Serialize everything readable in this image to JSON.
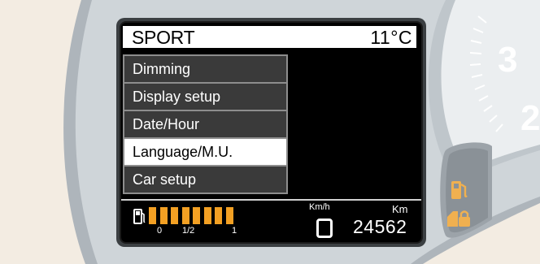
{
  "display": {
    "drive_mode": "SPORT",
    "temperature": "11°C",
    "menu_items": [
      {
        "label": "Dimming",
        "selected": false
      },
      {
        "label": "Display setup",
        "selected": false
      },
      {
        "label": "Date/Hour",
        "selected": false
      },
      {
        "label": "Language/M.U.",
        "selected": true
      },
      {
        "label": "Car setup",
        "selected": false
      }
    ],
    "fuel": {
      "level_fraction": 1.0,
      "segments": 8,
      "tick_labels": [
        "0",
        "1/2",
        "1"
      ],
      "color": "#f3a023",
      "icon": "fuel-pump-icon"
    },
    "speed_unit": "Km/h",
    "odometer_unit": "Km",
    "odometer_value": "24562",
    "gear_symbol": "rounded-square"
  },
  "gauge": {
    "visible_numbers": [
      "3",
      "2"
    ]
  },
  "warning_lights": [
    {
      "icon": "fuel-pump-warning-icon",
      "color": "#f0b050"
    },
    {
      "icon": "door-lock-warning-icon",
      "color": "#f0b050"
    }
  ],
  "colors": {
    "background": "#f3ece2",
    "bezel": "#c9ced2",
    "display": "#000000",
    "accent": "#f3a023"
  }
}
